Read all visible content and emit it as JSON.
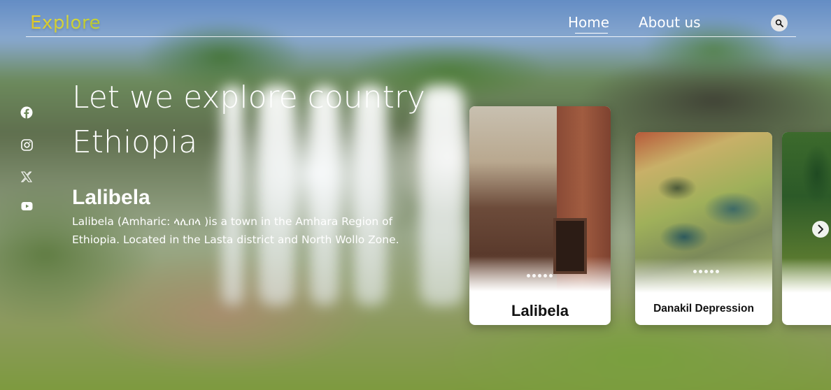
{
  "nav": {
    "logo": "Explore",
    "links": [
      {
        "label": "Home",
        "active": true
      },
      {
        "label": "About us",
        "active": false
      }
    ],
    "search_icon": "search-icon"
  },
  "socials": [
    {
      "icon": "facebook-icon"
    },
    {
      "icon": "instagram-icon"
    },
    {
      "icon": "x-twitter-icon"
    },
    {
      "icon": "youtube-icon"
    }
  ],
  "hero": {
    "title": "Let we explore country Ethiopia",
    "place_name": "Lalibela",
    "description": "Lalibela (Amharic: ላሊበላ )is a town in the Amhara Region of Ethiopia. Located in the Lasta district and North Wollo Zone."
  },
  "cards": [
    {
      "title": "Lalibela"
    },
    {
      "title": "Danakil Depression"
    },
    {
      "title": ""
    }
  ],
  "carousel": {
    "next_icon": "chevron-right-icon"
  },
  "colors": {
    "logo_gradient_start": "#f2d72a",
    "logo_gradient_end": "#c8d830",
    "text": "#ffffff",
    "card_bg": "#ffffff"
  }
}
